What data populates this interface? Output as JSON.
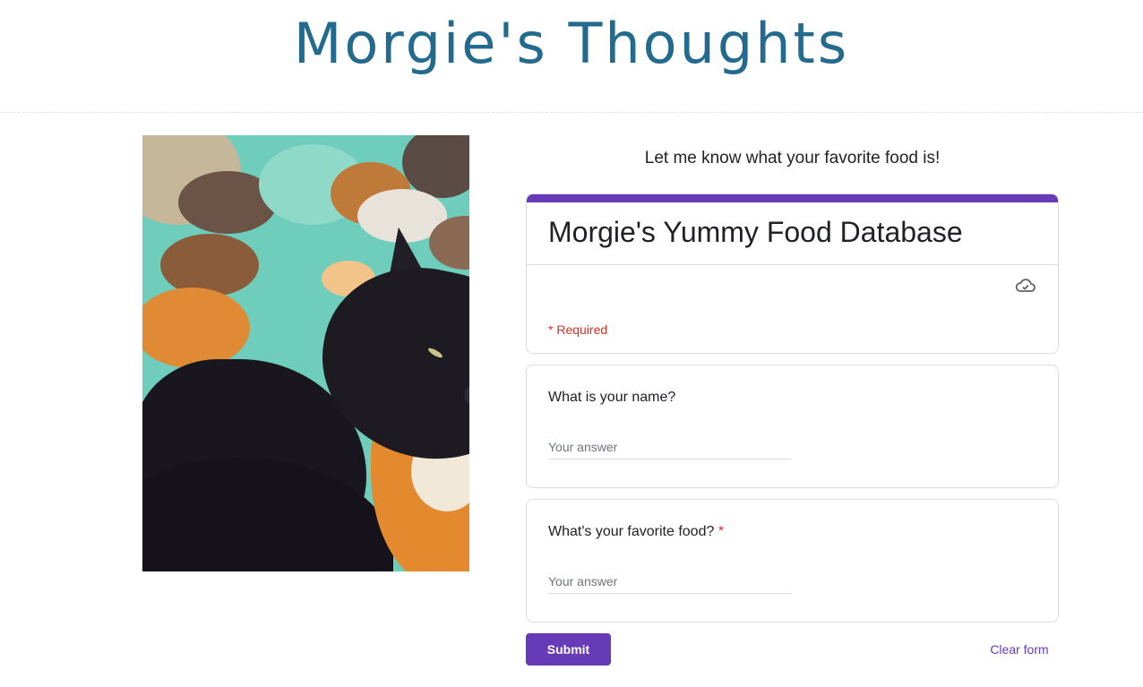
{
  "site": {
    "title": "Morgie's Thoughts"
  },
  "intro": {
    "text": "Let me know what your favorite food is!"
  },
  "form": {
    "accent_color": "#673ab7",
    "title": "Morgie's Yummy Food Database",
    "save_status_icon": "cloud-check-icon",
    "required_note": "* Required",
    "questions": [
      {
        "label": "What is your name?",
        "required": false,
        "placeholder": "Your answer",
        "value": ""
      },
      {
        "label": "What's your favorite food?",
        "required": true,
        "required_mark": "*",
        "placeholder": "Your answer",
        "value": ""
      }
    ],
    "submit_label": "Submit",
    "clear_label": "Clear form"
  },
  "photo": {
    "subject": "black cat lying on teal blanket beside orange plush toy"
  }
}
